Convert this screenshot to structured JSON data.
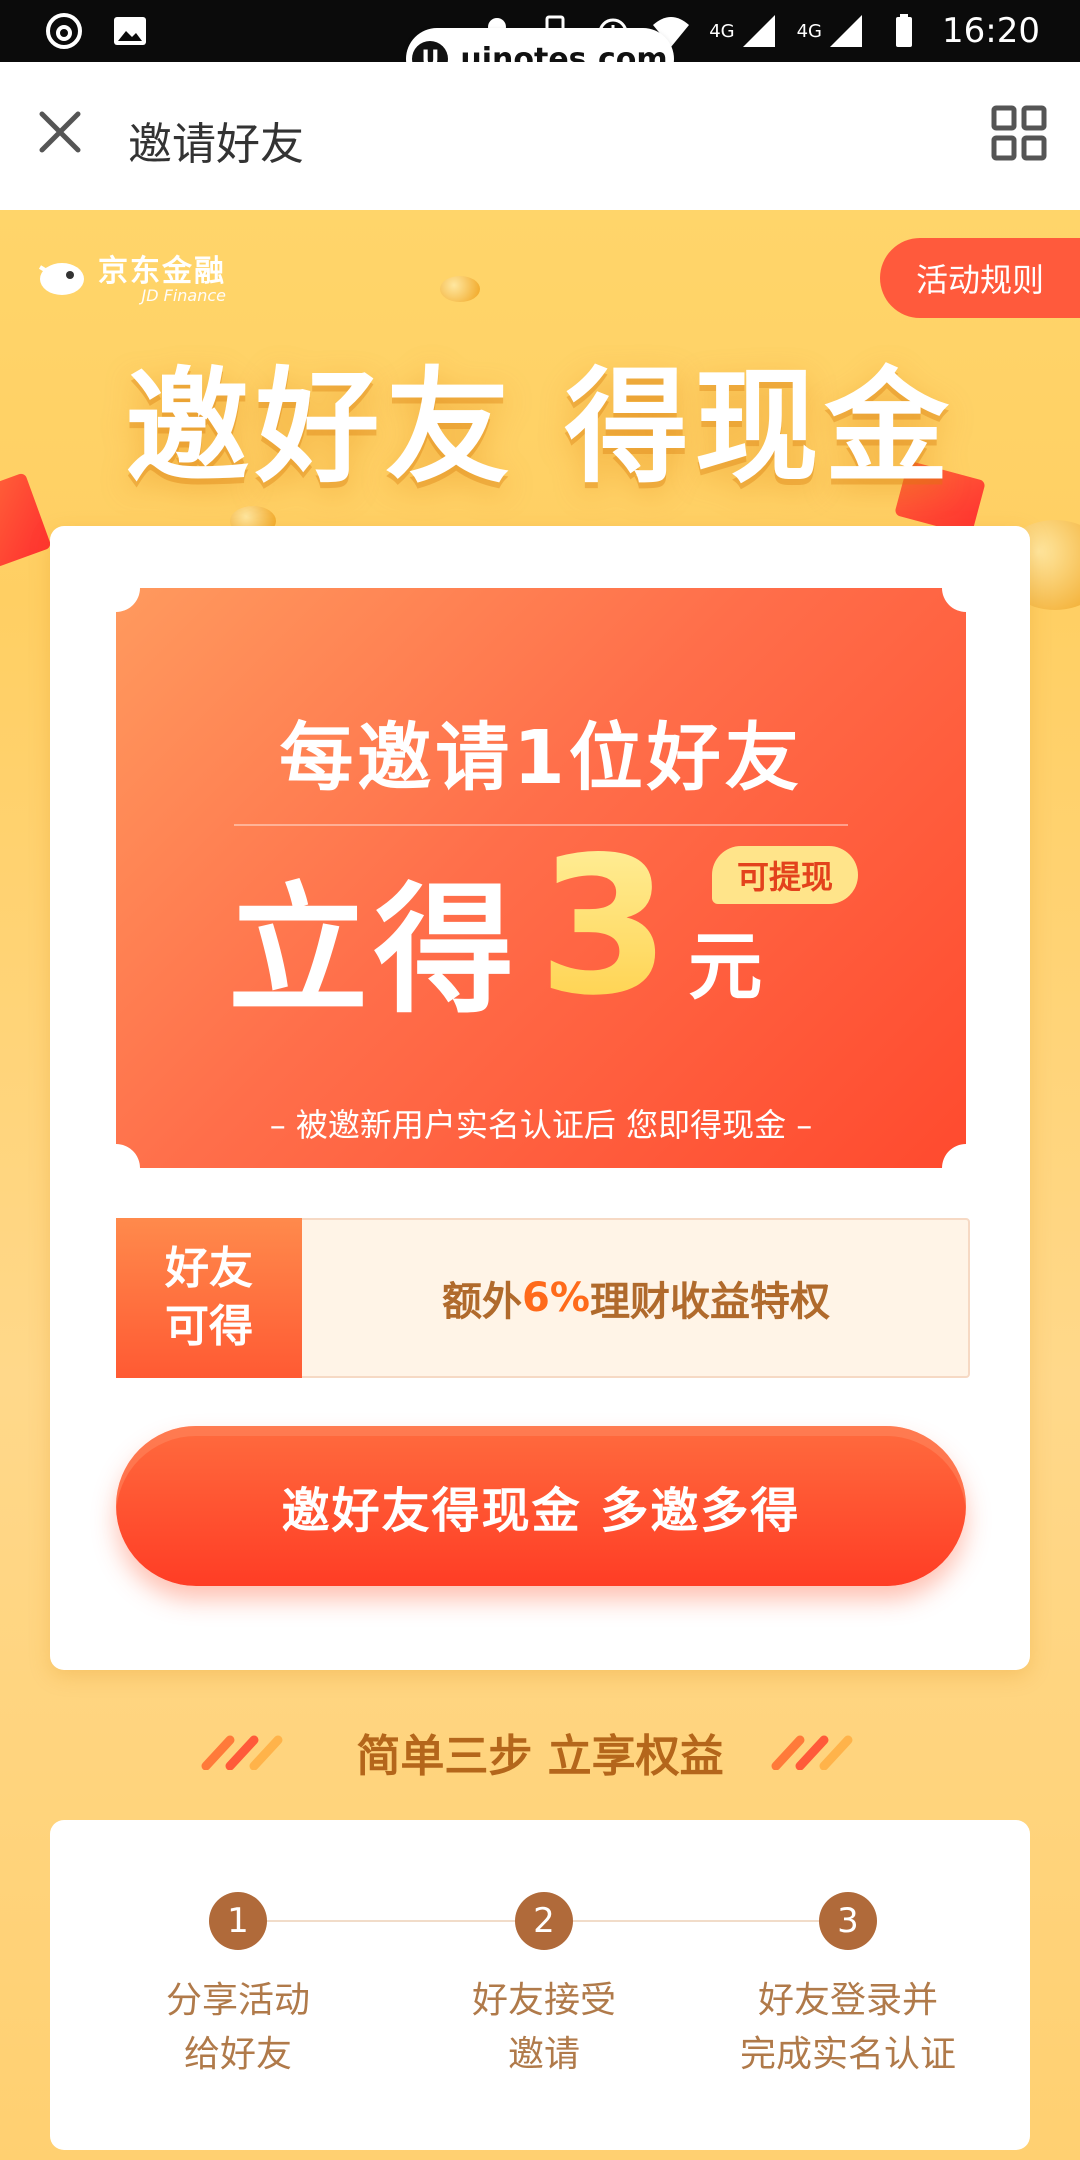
{
  "status_bar": {
    "time": "16:20",
    "network_1": "4G",
    "network_2": "4G",
    "watermark": "uinotes.com"
  },
  "app_bar": {
    "title": "邀请好友",
    "close_icon": "close-icon",
    "menu_icon": "grid-icon"
  },
  "hero": {
    "brand_name": "京东金融",
    "brand_sub": "JD Finance",
    "rules_label": "活动规则",
    "headline": "邀好友 得现金"
  },
  "reward_card": {
    "line1": "每邀请1位好友",
    "instant": "立得",
    "amount": "3",
    "unit": "元",
    "badge": "可提现",
    "note": "– 被邀新用户实名认证后 您即得现金 –"
  },
  "extra": {
    "tag": "好友可得",
    "text_before": "额外",
    "highlight": "6%",
    "text_after": "理财收益特权"
  },
  "cta_label": "邀好友得现金 多邀多得",
  "steps": {
    "title": "简单三步 立享权益",
    "items": [
      {
        "num": "1",
        "line1": "分享活动",
        "line2": "给好友"
      },
      {
        "num": "2",
        "line1": "好友接受",
        "line2": "邀请"
      },
      {
        "num": "3",
        "line1": "好友登录并",
        "line2": "完成实名认证"
      }
    ]
  },
  "colors": {
    "accent": "#ff4a2e",
    "background": "#ffd56a",
    "brown": "#b06a3a"
  }
}
